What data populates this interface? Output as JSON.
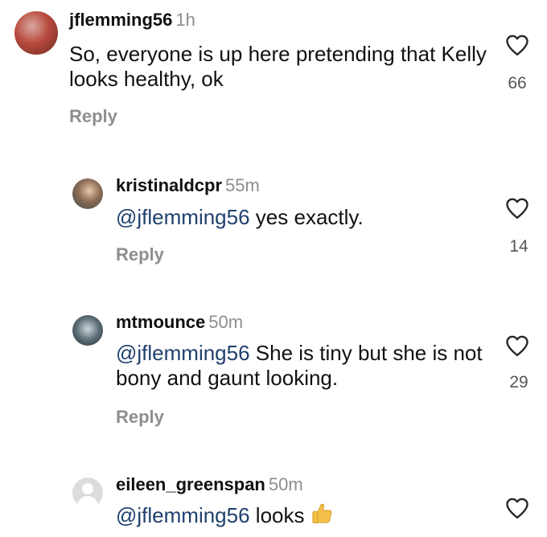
{
  "comments": [
    {
      "username": "jflemming56",
      "time": "1h",
      "text_line1": "So, everyone is up here pretending that Kelly",
      "text_line2": "looks healthy, ok",
      "reply_label": "Reply",
      "likes": "66"
    },
    {
      "username": "kristinaldcpr",
      "time": "55m",
      "mention": "@jflemming56",
      "text": "yes exactly.",
      "reply_label": "Reply",
      "likes": "14"
    },
    {
      "username": "mtmounce",
      "time": "50m",
      "mention": "@jflemming56",
      "text_line1": "She is tiny but she is not",
      "text_line2": "bony and gaunt looking.",
      "reply_label": "Reply",
      "likes": "29"
    },
    {
      "username": "eileen_greenspan",
      "time": "50m",
      "mention": "@jflemming56",
      "text": "looks",
      "emoji": "thumbs-up-emoji"
    }
  ],
  "colors": {
    "mention": "#1f3f6e",
    "meta": "#8e8e8e"
  },
  "icons": [
    "heart-icon",
    "avatar",
    "thumbs-up-emoji"
  ]
}
